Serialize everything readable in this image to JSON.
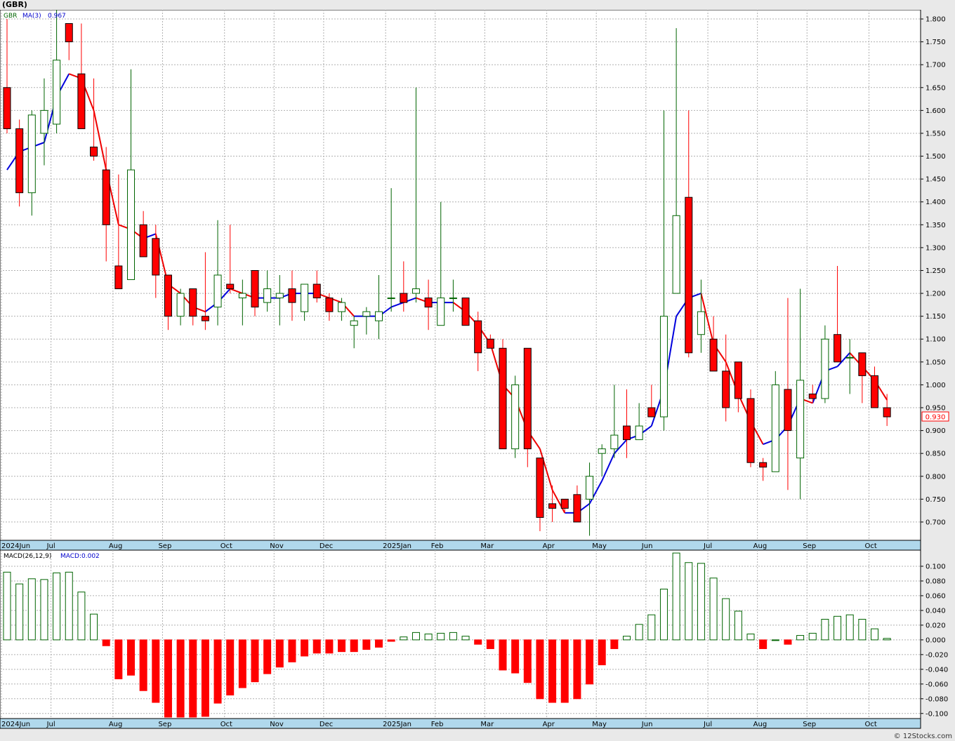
{
  "title": "(GBR)",
  "credit": "© 12Stocks.com",
  "colors": {
    "up": "#006400",
    "down": "#ff0000",
    "ma_up": "#0000dd",
    "ma_down": "#ee0000",
    "grid": "#b0b0b0",
    "axis_band": "#b0d8ec",
    "last_price_box": "#ff0000"
  },
  "chart_data": [
    {
      "type": "candlestick",
      "ticker": "GBR",
      "ma_label": "MA(3)",
      "ma_value": "0.967",
      "last_price": "0.930",
      "ylim": [
        0.66,
        1.82
      ],
      "y_ticks": [
        "1.800",
        "1.750",
        "1.700",
        "1.650",
        "1.600",
        "1.550",
        "1.500",
        "1.450",
        "1.400",
        "1.350",
        "1.300",
        "1.250",
        "1.200",
        "1.150",
        "1.100",
        "1.050",
        "1.000",
        "0.950",
        "0.900",
        "0.850",
        "0.800",
        "0.750",
        "0.700"
      ],
      "month_labels": [
        {
          "label": "2024Jun",
          "week": 0
        },
        {
          "label": "Jul",
          "week": 4
        },
        {
          "label": "Aug",
          "week": 9
        },
        {
          "label": "Sep",
          "week": 13
        },
        {
          "label": "Oct",
          "week": 18
        },
        {
          "label": "Nov",
          "week": 22
        },
        {
          "label": "Dec",
          "week": 26
        },
        {
          "label": "2025Jan",
          "week": 31
        },
        {
          "label": "Feb",
          "week": 35
        },
        {
          "label": "Mar",
          "week": 39
        },
        {
          "label": "Apr",
          "week": 44
        },
        {
          "label": "May",
          "week": 48
        },
        {
          "label": "Jun",
          "week": 52
        },
        {
          "label": "Jul",
          "week": 57
        },
        {
          "label": "Aug",
          "week": 61
        },
        {
          "label": "Sep",
          "week": 65
        },
        {
          "label": "Oct",
          "week": 70
        }
      ],
      "candles": [
        {
          "o": 1.65,
          "h": 1.8,
          "l": 1.55,
          "c": 1.56
        },
        {
          "o": 1.56,
          "h": 1.58,
          "l": 1.39,
          "c": 1.42
        },
        {
          "o": 1.42,
          "h": 1.6,
          "l": 1.37,
          "c": 1.59
        },
        {
          "o": 1.55,
          "h": 1.67,
          "l": 1.48,
          "c": 1.6
        },
        {
          "o": 1.57,
          "h": 1.82,
          "l": 1.55,
          "c": 1.71
        },
        {
          "o": 1.79,
          "h": 1.79,
          "l": 1.71,
          "c": 1.75
        },
        {
          "o": 1.68,
          "h": 1.79,
          "l": 1.56,
          "c": 1.56
        },
        {
          "o": 1.52,
          "h": 1.67,
          "l": 1.49,
          "c": 1.5
        },
        {
          "o": 1.47,
          "h": 1.52,
          "l": 1.27,
          "c": 1.35
        },
        {
          "o": 1.26,
          "h": 1.46,
          "l": 1.21,
          "c": 1.21
        },
        {
          "o": 1.23,
          "h": 1.69,
          "l": 1.23,
          "c": 1.47
        },
        {
          "o": 1.35,
          "h": 1.38,
          "l": 1.28,
          "c": 1.28
        },
        {
          "o": 1.32,
          "h": 1.35,
          "l": 1.19,
          "c": 1.24
        },
        {
          "o": 1.24,
          "h": 1.24,
          "l": 1.12,
          "c": 1.15
        },
        {
          "o": 1.15,
          "h": 1.21,
          "l": 1.13,
          "c": 1.2
        },
        {
          "o": 1.21,
          "h": 1.21,
          "l": 1.13,
          "c": 1.15
        },
        {
          "o": 1.15,
          "h": 1.29,
          "l": 1.12,
          "c": 1.14
        },
        {
          "o": 1.17,
          "h": 1.36,
          "l": 1.13,
          "c": 1.24
        },
        {
          "o": 1.22,
          "h": 1.35,
          "l": 1.2,
          "c": 1.21
        },
        {
          "o": 1.19,
          "h": 1.23,
          "l": 1.13,
          "c": 1.2
        },
        {
          "o": 1.25,
          "h": 1.25,
          "l": 1.15,
          "c": 1.17
        },
        {
          "o": 1.18,
          "h": 1.25,
          "l": 1.16,
          "c": 1.21
        },
        {
          "o": 1.19,
          "h": 1.24,
          "l": 1.13,
          "c": 1.2
        },
        {
          "o": 1.21,
          "h": 1.25,
          "l": 1.14,
          "c": 1.18
        },
        {
          "o": 1.16,
          "h": 1.22,
          "l": 1.14,
          "c": 1.22
        },
        {
          "o": 1.22,
          "h": 1.25,
          "l": 1.18,
          "c": 1.19
        },
        {
          "o": 1.19,
          "h": 1.2,
          "l": 1.14,
          "c": 1.16
        },
        {
          "o": 1.16,
          "h": 1.19,
          "l": 1.14,
          "c": 1.18
        },
        {
          "o": 1.13,
          "h": 1.15,
          "l": 1.08,
          "c": 1.14
        },
        {
          "o": 1.15,
          "h": 1.17,
          "l": 1.11,
          "c": 1.16
        },
        {
          "o": 1.14,
          "h": 1.24,
          "l": 1.1,
          "c": 1.16
        },
        {
          "o": 1.19,
          "h": 1.43,
          "l": 1.16,
          "c": 1.19
        },
        {
          "o": 1.2,
          "h": 1.27,
          "l": 1.16,
          "c": 1.18
        },
        {
          "o": 1.2,
          "h": 1.65,
          "l": 1.18,
          "c": 1.21
        },
        {
          "o": 1.19,
          "h": 1.23,
          "l": 1.12,
          "c": 1.17
        },
        {
          "o": 1.13,
          "h": 1.4,
          "l": 1.13,
          "c": 1.19
        },
        {
          "o": 1.19,
          "h": 1.23,
          "l": 1.16,
          "c": 1.19
        },
        {
          "o": 1.19,
          "h": 1.19,
          "l": 1.13,
          "c": 1.13
        },
        {
          "o": 1.14,
          "h": 1.16,
          "l": 1.03,
          "c": 1.07
        },
        {
          "o": 1.1,
          "h": 1.11,
          "l": 1.08,
          "c": 1.08
        },
        {
          "o": 1.08,
          "h": 1.1,
          "l": 0.86,
          "c": 0.86
        },
        {
          "o": 0.86,
          "h": 1.02,
          "l": 0.84,
          "c": 1.0
        },
        {
          "o": 1.08,
          "h": 1.08,
          "l": 0.82,
          "c": 0.86
        },
        {
          "o": 0.84,
          "h": 0.84,
          "l": 0.68,
          "c": 0.71
        },
        {
          "o": 0.74,
          "h": 0.78,
          "l": 0.7,
          "c": 0.73
        },
        {
          "o": 0.75,
          "h": 0.75,
          "l": 0.72,
          "c": 0.73
        },
        {
          "o": 0.76,
          "h": 0.78,
          "l": 0.7,
          "c": 0.7
        },
        {
          "o": 0.75,
          "h": 0.83,
          "l": 0.67,
          "c": 0.8
        },
        {
          "o": 0.85,
          "h": 0.87,
          "l": 0.8,
          "c": 0.86
        },
        {
          "o": 0.86,
          "h": 1.0,
          "l": 0.84,
          "c": 0.89
        },
        {
          "o": 0.91,
          "h": 0.99,
          "l": 0.84,
          "c": 0.88
        },
        {
          "o": 0.88,
          "h": 0.96,
          "l": 0.88,
          "c": 0.91
        },
        {
          "o": 0.95,
          "h": 1.0,
          "l": 0.93,
          "c": 0.93
        },
        {
          "o": 0.93,
          "h": 1.6,
          "l": 0.9,
          "c": 1.15
        },
        {
          "o": 1.2,
          "h": 1.78,
          "l": 1.2,
          "c": 1.37
        },
        {
          "o": 1.41,
          "h": 1.6,
          "l": 1.06,
          "c": 1.07
        },
        {
          "o": 1.11,
          "h": 1.23,
          "l": 1.07,
          "c": 1.16
        },
        {
          "o": 1.1,
          "h": 1.15,
          "l": 1.03,
          "c": 1.03
        },
        {
          "o": 1.03,
          "h": 1.11,
          "l": 0.92,
          "c": 0.95
        },
        {
          "o": 1.05,
          "h": 1.05,
          "l": 0.94,
          "c": 0.97
        },
        {
          "o": 0.97,
          "h": 0.99,
          "l": 0.82,
          "c": 0.83
        },
        {
          "o": 0.83,
          "h": 0.84,
          "l": 0.79,
          "c": 0.82
        },
        {
          "o": 0.81,
          "h": 1.03,
          "l": 0.81,
          "c": 1.0
        },
        {
          "o": 0.99,
          "h": 1.19,
          "l": 0.77,
          "c": 0.9
        },
        {
          "o": 0.84,
          "h": 1.21,
          "l": 0.75,
          "c": 1.01
        },
        {
          "o": 0.98,
          "h": 1.0,
          "l": 0.96,
          "c": 0.97
        },
        {
          "o": 0.97,
          "h": 1.13,
          "l": 0.96,
          "c": 1.1
        },
        {
          "o": 1.11,
          "h": 1.26,
          "l": 1.05,
          "c": 1.05
        },
        {
          "o": 1.06,
          "h": 1.1,
          "l": 0.98,
          "c": 1.06
        },
        {
          "o": 1.07,
          "h": 1.07,
          "l": 0.96,
          "c": 1.02
        },
        {
          "o": 1.02,
          "h": 1.04,
          "l": 0.95,
          "c": 0.95
        },
        {
          "o": 0.95,
          "h": 0.98,
          "l": 0.91,
          "c": 0.93
        }
      ],
      "ma3": [
        1.47,
        1.51,
        1.52,
        1.53,
        1.63,
        1.68,
        1.67,
        1.6,
        1.47,
        1.35,
        1.34,
        1.32,
        1.33,
        1.22,
        1.2,
        1.17,
        1.16,
        1.18,
        1.21,
        1.2,
        1.19,
        1.19,
        1.19,
        1.2,
        1.2,
        1.2,
        1.19,
        1.18,
        1.15,
        1.15,
        1.15,
        1.17,
        1.18,
        1.19,
        1.18,
        1.18,
        1.18,
        1.16,
        1.13,
        1.09,
        1.0,
        0.97,
        0.9,
        0.86,
        0.77,
        0.72,
        0.72,
        0.74,
        0.79,
        0.85,
        0.88,
        0.89,
        0.91,
        0.99,
        1.15,
        1.19,
        1.2,
        1.09,
        1.05,
        0.98,
        0.92,
        0.87,
        0.88,
        0.91,
        0.97,
        0.96,
        1.03,
        1.04,
        1.07,
        1.04,
        1.01,
        0.967
      ]
    },
    {
      "type": "bar",
      "label": "MACD(26,12,9)",
      "value_label": "MACD:0.002",
      "ylim": [
        -0.105,
        0.12
      ],
      "y_ticks": [
        "0.100",
        "0.080",
        "0.060",
        "0.040",
        "0.020",
        "0.000",
        "-0.020",
        "-0.040",
        "-0.060",
        "-0.080",
        "-0.100"
      ],
      "values": [
        0.092,
        0.076,
        0.083,
        0.082,
        0.091,
        0.092,
        0.065,
        0.035,
        -0.008,
        -0.053,
        -0.048,
        -0.069,
        -0.085,
        -0.105,
        -0.105,
        -0.105,
        -0.104,
        -0.086,
        -0.075,
        -0.065,
        -0.057,
        -0.046,
        -0.037,
        -0.03,
        -0.022,
        -0.018,
        -0.018,
        -0.016,
        -0.016,
        -0.013,
        -0.01,
        -0.002,
        0.004,
        0.01,
        0.008,
        0.009,
        0.01,
        0.005,
        -0.006,
        -0.012,
        -0.041,
        -0.045,
        -0.058,
        -0.08,
        -0.085,
        -0.085,
        -0.08,
        -0.06,
        -0.034,
        -0.012,
        0.005,
        0.021,
        0.034,
        0.069,
        0.118,
        0.105,
        0.104,
        0.084,
        0.056,
        0.039,
        0.008,
        -0.012,
        0.0,
        -0.006,
        0.006,
        0.009,
        0.028,
        0.032,
        0.034,
        0.028,
        0.015,
        0.002
      ]
    }
  ]
}
